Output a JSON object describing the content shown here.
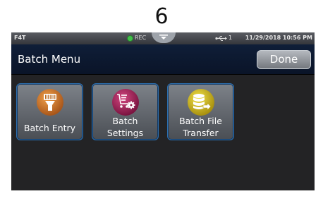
{
  "page": {
    "number": "6"
  },
  "status_bar": {
    "model": "F4T",
    "rec": "REC",
    "usb_count": "1",
    "datetime": "11/29/2018 10:56 PM"
  },
  "header": {
    "title": "Batch Menu",
    "done_label": "Done"
  },
  "tiles": [
    {
      "line1": "Batch Entry",
      "icon": "barcode-scanner-icon",
      "color": "#c9762a"
    },
    {
      "line1": "Batch",
      "line2": "Settings",
      "icon": "cart-gear-icon",
      "color": "#9b1f52"
    },
    {
      "line1": "Batch File",
      "line2": "Transfer",
      "icon": "database-transfer-icon",
      "color": "#c8b21e"
    }
  ],
  "colors": {
    "screen_background": "#232325",
    "title_bar": "#0f1e38",
    "tile_border": "#2c6fb0",
    "rec_indicator": "#42c04a"
  }
}
